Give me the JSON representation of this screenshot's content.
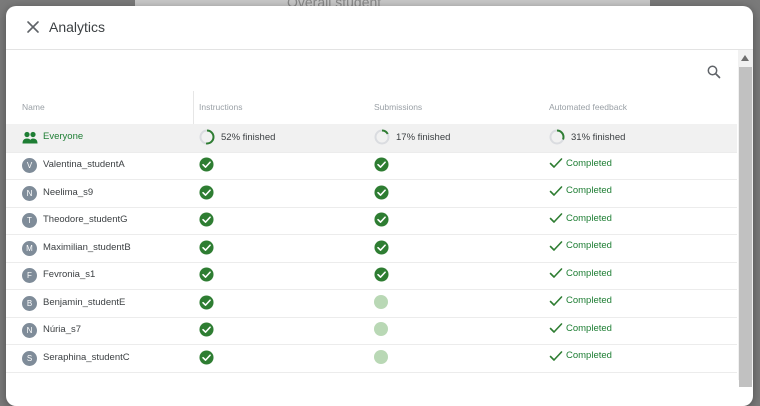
{
  "background": {
    "partial_text": "Overall student"
  },
  "dialog": {
    "title": "Analytics",
    "columns": {
      "name": "Name",
      "instructions": "Instructions",
      "submissions": "Submissions",
      "automated_feedback": "Automated feedback"
    },
    "everyone": {
      "label": "Everyone",
      "instructions_progress": "52% finished",
      "instructions_fraction": 0.52,
      "submissions_progress": "17% finished",
      "submissions_fraction": 0.17,
      "feedback_progress": "31% finished",
      "feedback_fraction": 0.31
    },
    "students": [
      {
        "initial": "V",
        "name": "Valentina_studentA",
        "instructions": "done",
        "submissions": "done",
        "feedback": "Completed"
      },
      {
        "initial": "N",
        "name": "Neelima_s9",
        "instructions": "done",
        "submissions": "done",
        "feedback": "Completed"
      },
      {
        "initial": "T",
        "name": "Theodore_studentG",
        "instructions": "done",
        "submissions": "done",
        "feedback": "Completed"
      },
      {
        "initial": "M",
        "name": "Maximilian_studentB",
        "instructions": "done",
        "submissions": "done",
        "feedback": "Completed"
      },
      {
        "initial": "F",
        "name": "Fevronia_s1",
        "instructions": "done",
        "submissions": "done",
        "feedback": "Completed"
      },
      {
        "initial": "B",
        "name": "Benjamin_studentE",
        "instructions": "done",
        "submissions": "pending",
        "feedback": "Completed"
      },
      {
        "initial": "N",
        "name": "Núria_s7",
        "instructions": "done",
        "submissions": "pending",
        "feedback": "Completed"
      },
      {
        "initial": "S",
        "name": "Seraphina_studentC",
        "instructions": "done",
        "submissions": "pending",
        "feedback": "Completed"
      }
    ]
  },
  "colors": {
    "accent_green": "#1e7e34",
    "check_green": "#2e7d32",
    "pending_green": "#b9d8b5",
    "avatar_gray": "#7f8c99"
  },
  "icons": {
    "close": "close-icon",
    "search": "search-icon",
    "group": "group-icon",
    "check": "check-circle-icon",
    "feedback_check": "checkmark-icon"
  }
}
